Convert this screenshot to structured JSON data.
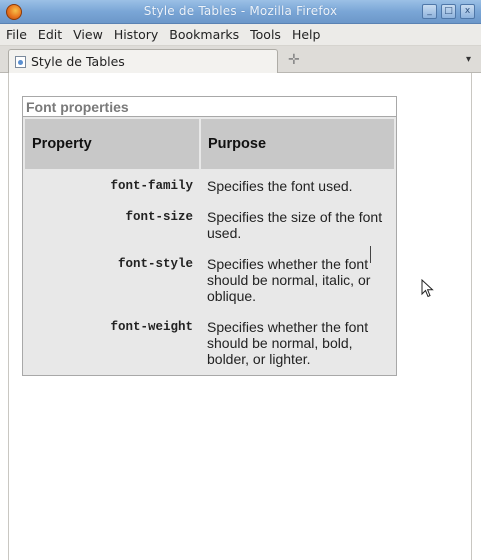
{
  "window": {
    "title": "Style de Tables - Mozilla Firefox",
    "app_icon": "firefox-icon",
    "buttons": {
      "minimize": "_",
      "maximize": "□",
      "close": "x"
    }
  },
  "menubar": {
    "items": [
      "File",
      "Edit",
      "View",
      "History",
      "Bookmarks",
      "Tools",
      "Help"
    ]
  },
  "tabs": {
    "items": [
      {
        "label": "Style de Tables",
        "icon": "page-icon"
      }
    ],
    "new_tab_icon": "✛",
    "list_all_icon": "▾"
  },
  "table": {
    "caption": "Font properties",
    "headers": [
      "Property",
      "Purpose"
    ],
    "rows": [
      {
        "property": "font-family",
        "purpose": "Specifies the font used."
      },
      {
        "property": "font-size",
        "purpose": "Specifies the size of the font used."
      },
      {
        "property": "font-style",
        "purpose": "Specifies whether the font should be normal, italic, or oblique."
      },
      {
        "property": "font-weight",
        "purpose": "Specifies whether the font should be normal, bold, bolder, or lighter."
      }
    ]
  },
  "colors": {
    "titlebar": "#7aa6d6",
    "header_cell": "#c8c8c8",
    "table_bg": "#e8e8e8",
    "caption_text": "#7a7a7a"
  }
}
